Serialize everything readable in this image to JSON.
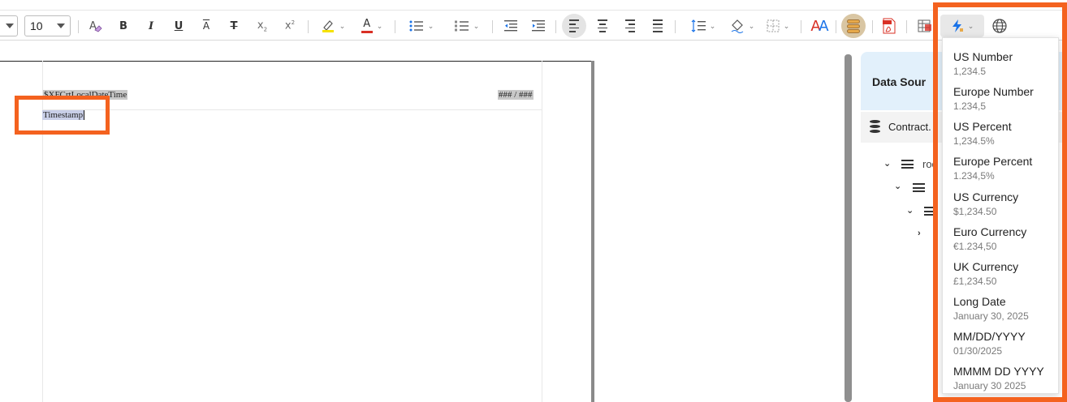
{
  "toolbar": {
    "font_name": "",
    "font_size": "10",
    "buttons": {
      "bold": "B",
      "italic": "I",
      "underline": "U",
      "overline": "A",
      "strike": "T",
      "subscript": "x",
      "sub_mark": "2",
      "superscript": "x",
      "sup_mark": "2",
      "font_color": "A",
      "text_styles": "A"
    }
  },
  "document": {
    "header_field": "$XFCrtLocalDateTime",
    "page_counter": "### / ###",
    "timestamp_field": "Timestamp"
  },
  "panel": {
    "title": "Data Sour",
    "data_source_label": "Contract.",
    "tree": [
      "roo"
    ]
  },
  "format_menu": {
    "items": [
      {
        "label": "US Number",
        "sample": "1,234.5"
      },
      {
        "label": "Europe Number",
        "sample": "1.234,5"
      },
      {
        "label": "US Percent",
        "sample": "1,234.5%"
      },
      {
        "label": "Europe Percent",
        "sample": "1.234,5%"
      },
      {
        "label": "US Currency",
        "sample": "$1,234.50"
      },
      {
        "label": "Euro Currency",
        "sample": "€1.234,50"
      },
      {
        "label": "UK Currency",
        "sample": "£1,234.50"
      },
      {
        "label": "Long Date",
        "sample": "January 30, 2025"
      },
      {
        "label": "MM/DD/YYYY",
        "sample": "01/30/2025"
      },
      {
        "label": "MMMM DD YYYY",
        "sample": "January 30 2025"
      }
    ]
  },
  "colors": {
    "highlight_frame": "#f4621f",
    "panel_header": "#e2f0fb",
    "highlighter": "#f6e200",
    "font_color_bar": "#d93025",
    "accent_icon": "#1a73e8"
  }
}
